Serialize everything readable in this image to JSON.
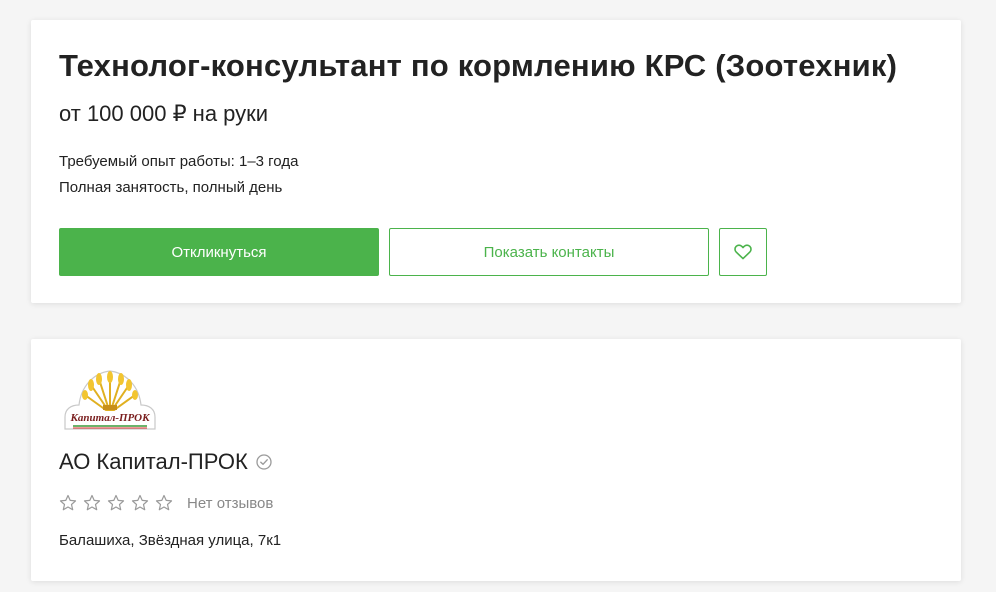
{
  "vacancy": {
    "title": "Технолог-консультант по кормлению КРС (Зоотехник)",
    "salary": "от 100 000 ₽ на руки",
    "experience": "Требуемый опыт работы: 1–3 года",
    "employment": "Полная занятость, полный день",
    "buttons": {
      "respond": "Откликнуться",
      "show_contacts": "Показать контакты",
      "favorite_icon": "heart-icon"
    }
  },
  "company": {
    "logo_text": "Капитал-ПРОК",
    "name": "АО Капитал-ПРОК",
    "verified_icon": "check-circle-icon",
    "rating": {
      "stars_filled": 0,
      "stars_total": 5,
      "reviews_text": "Нет отзывов"
    },
    "address": "Балашиха, Звёздная улица, 7к1"
  },
  "colors": {
    "accent": "#4bb34b",
    "background": "#f5f5f5",
    "card": "#ffffff",
    "muted_text": "#888888"
  }
}
